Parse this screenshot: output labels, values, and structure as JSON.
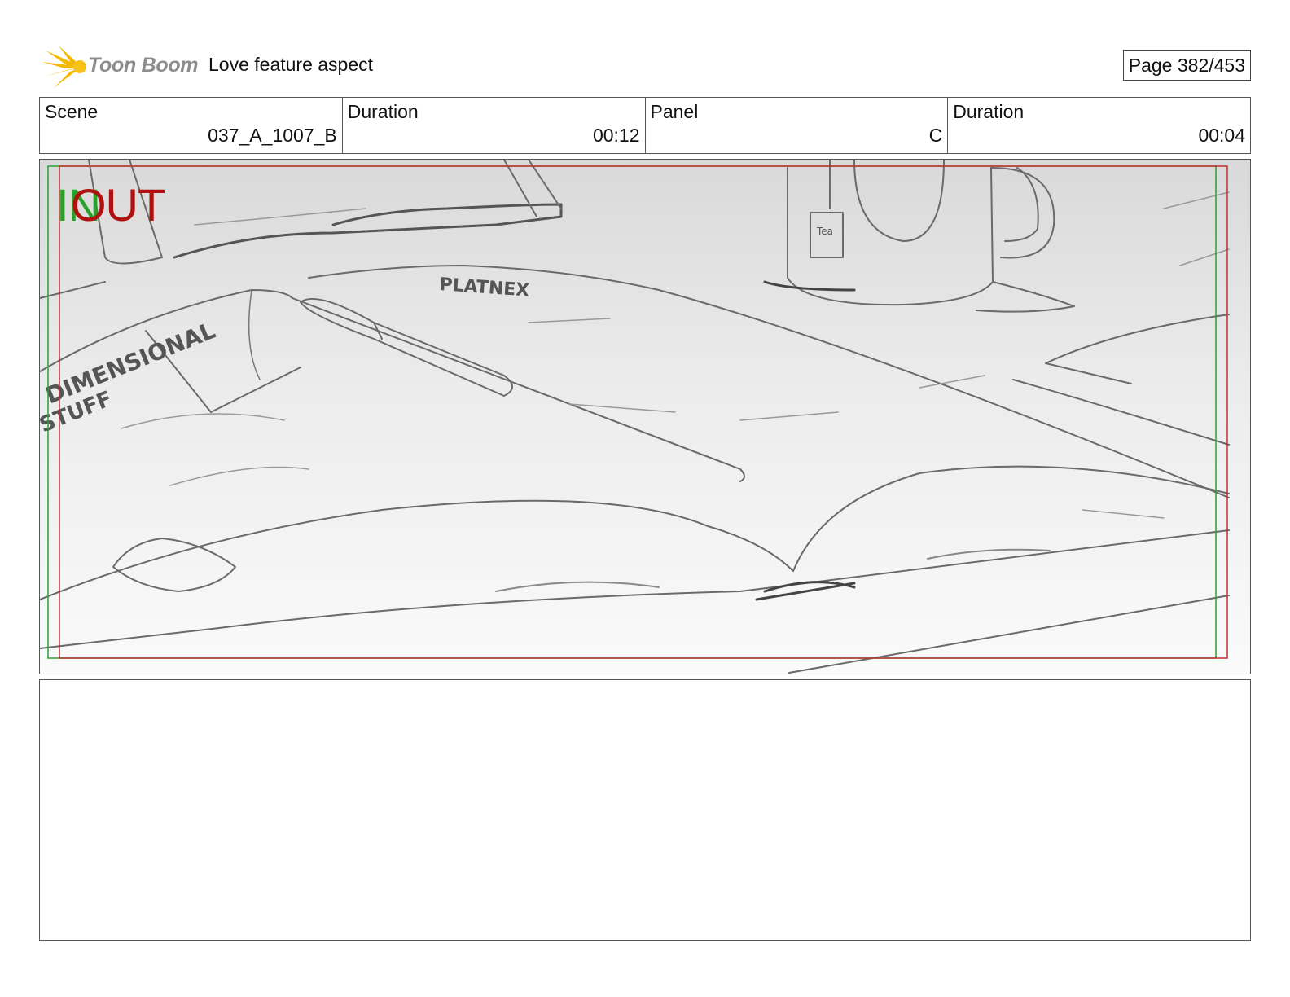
{
  "header": {
    "logo_text": "Toon Boom",
    "title": "Love feature aspect",
    "page": "Page 382/453"
  },
  "info": [
    {
      "label": "Scene",
      "value": "037_A_1007_B"
    },
    {
      "label": "Duration",
      "value": "00:12"
    },
    {
      "label": "Panel",
      "value": "C"
    },
    {
      "label": "Duration",
      "value": "00:04"
    }
  ],
  "panel": {
    "in_label": "IN",
    "out_label": "OUT",
    "sketch_text": {
      "book_cover_line1": "DIMENSIONAL",
      "book_cover_line2": "STUFF",
      "pen_label": "PLATNEX",
      "tea_tag": "Tea"
    }
  },
  "colors": {
    "in_marker": "#2aa02a",
    "out_marker": "#b01010",
    "logo_star": "#f5b800"
  },
  "notes": ""
}
